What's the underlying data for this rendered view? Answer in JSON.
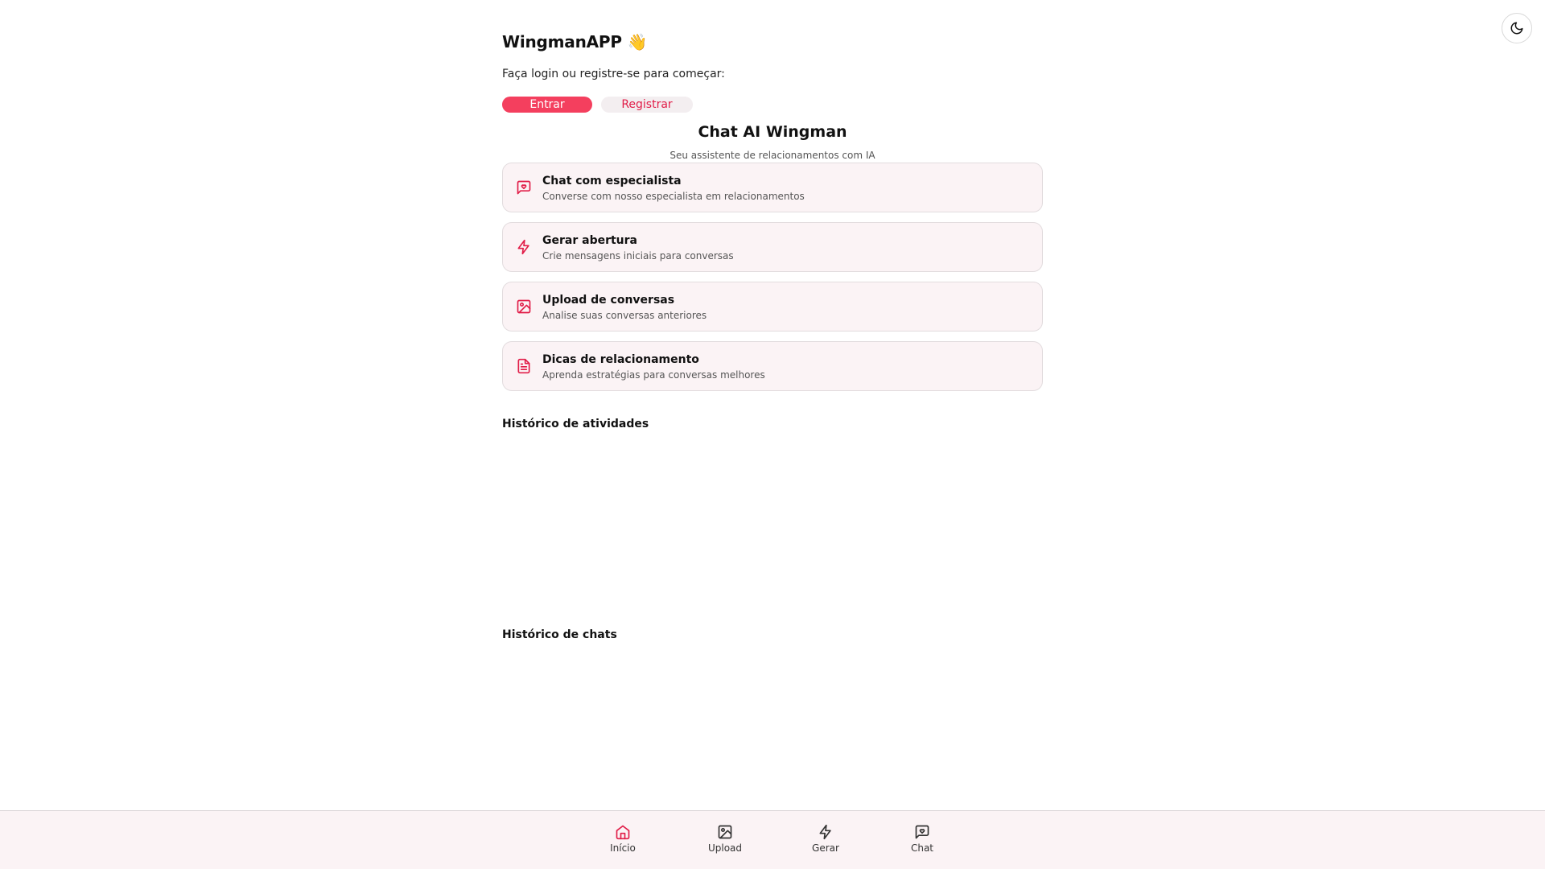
{
  "app": {
    "title": "WingmanAPP 👋",
    "subtitle": "Faça login ou registre-se para começar:"
  },
  "auth": {
    "login_label": "Entrar",
    "register_label": "Registrar"
  },
  "section": {
    "title": "Chat AI Wingman",
    "subtitle": "Seu assistente de relacionamentos com IA"
  },
  "features": [
    {
      "title": "Chat com especialista",
      "description": "Converse com nosso especialista em relacionamentos",
      "icon": "chat-heart-icon"
    },
    {
      "title": "Gerar abertura",
      "description": "Crie mensagens iniciais para conversas",
      "icon": "lightning-icon"
    },
    {
      "title": "Upload de conversas",
      "description": "Analise suas conversas anteriores",
      "icon": "image-icon"
    },
    {
      "title": "Dicas de relacionamento",
      "description": "Aprenda estratégias para conversas melhores",
      "icon": "document-icon"
    }
  ],
  "history": {
    "activities_title": "Histórico de atividades",
    "chats_title": "Histórico de chats"
  },
  "nav": [
    {
      "label": "Início",
      "icon": "home-icon",
      "active": true
    },
    {
      "label": "Upload",
      "icon": "image-icon",
      "active": false
    },
    {
      "label": "Gerar",
      "icon": "lightning-icon",
      "active": false
    },
    {
      "label": "Chat",
      "icon": "chat-heart-icon",
      "active": false
    }
  ],
  "colors": {
    "accent": "#f43f5e",
    "accent_dark": "#e11d48",
    "card_bg": "#fbf3f5",
    "border": "#e2dcde"
  }
}
